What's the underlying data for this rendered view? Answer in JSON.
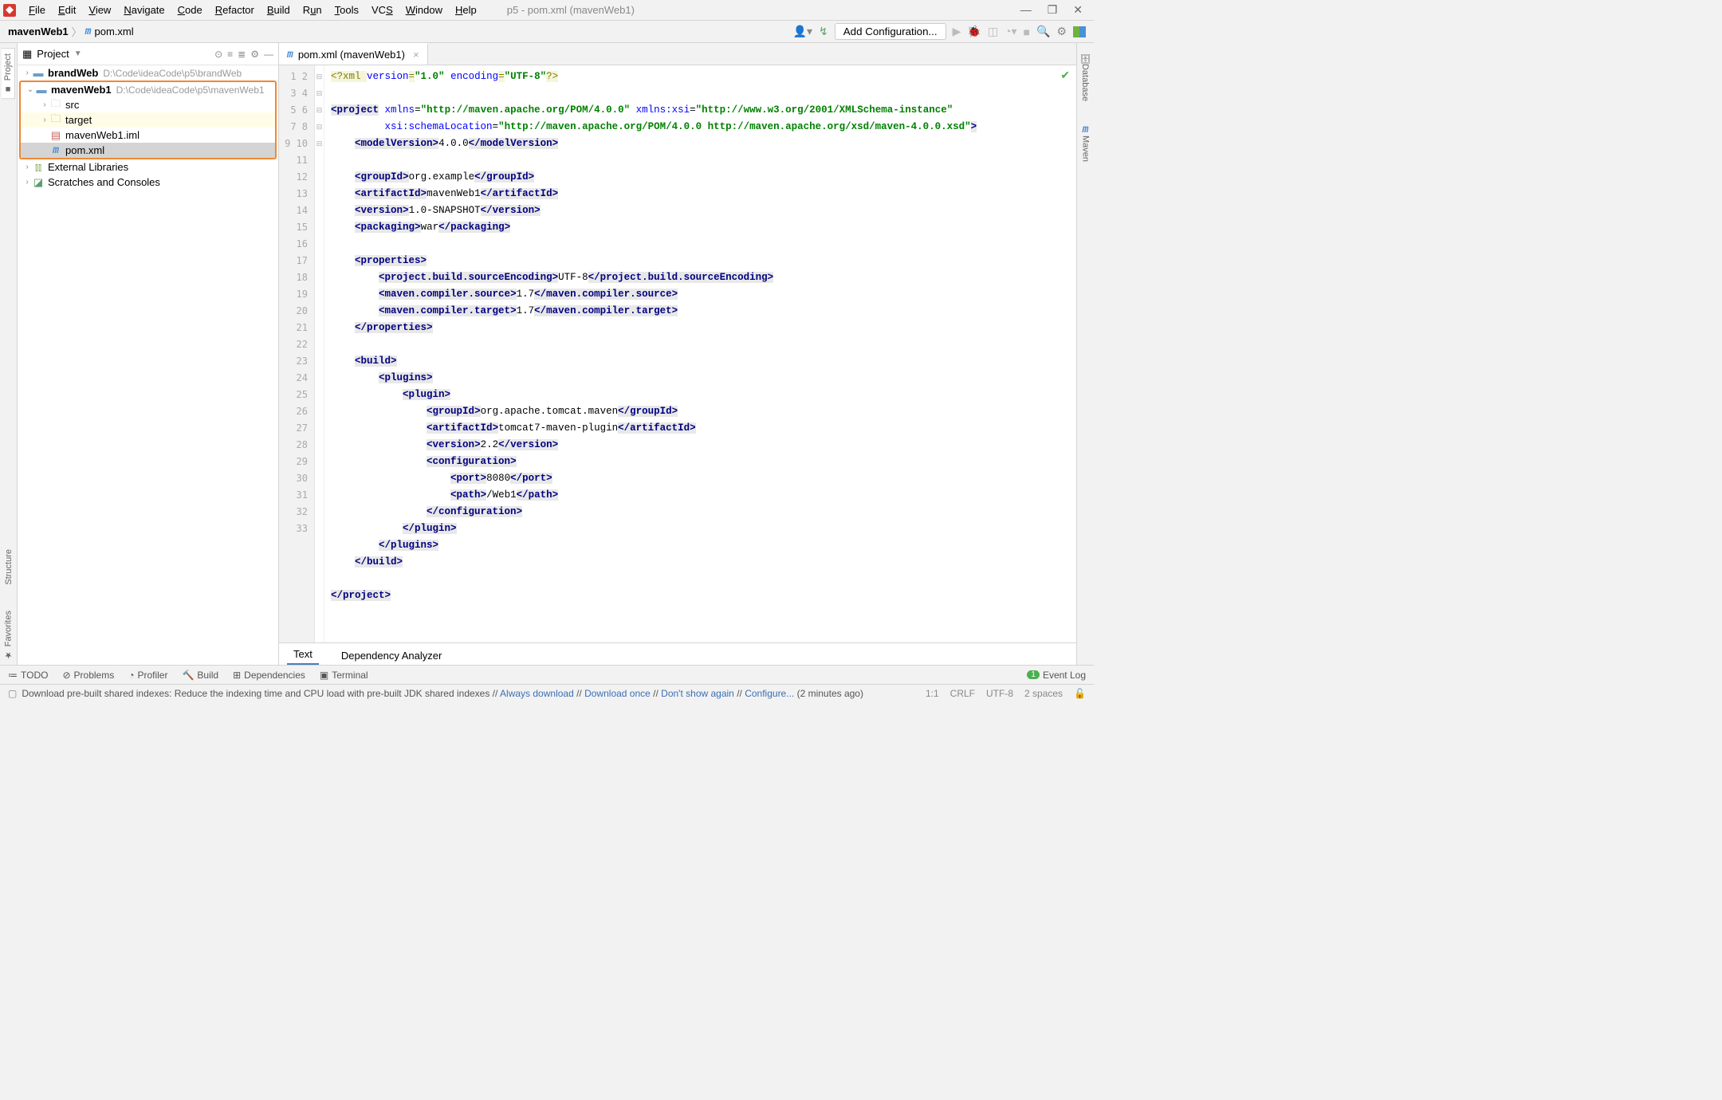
{
  "window": {
    "title": "p5 - pom.xml (mavenWeb1)"
  },
  "menu": [
    "File",
    "Edit",
    "View",
    "Navigate",
    "Code",
    "Refactor",
    "Build",
    "Run",
    "Tools",
    "VCS",
    "Window",
    "Help"
  ],
  "breadcrumb": {
    "project": "mavenWeb1",
    "file": "pom.xml"
  },
  "navRight": {
    "configBtn": "Add Configuration..."
  },
  "projectPanel": {
    "title": "Project"
  },
  "tree": {
    "brandWeb": {
      "name": "brandWeb",
      "path": "D:\\Code\\ideaCode\\p5\\brandWeb"
    },
    "mavenWeb1": {
      "name": "mavenWeb1",
      "path": "D:\\Code\\ideaCode\\p5\\mavenWeb1",
      "children": {
        "src": "src",
        "target": "target",
        "iml": "mavenWeb1.iml",
        "pom": "pom.xml"
      }
    },
    "extLib": "External Libraries",
    "scratches": "Scratches and Consoles"
  },
  "editorTab": {
    "label": "pom.xml (mavenWeb1)"
  },
  "code": {
    "l1": {
      "pi1": "<?xml ",
      "a1": "version",
      "v1": "\"1.0\"",
      "a2": " encoding",
      "v2": "\"UTF-8\"",
      "pi2": "?>"
    },
    "l3": {
      "tag": "project",
      "a1": "xmlns",
      "v1": "\"http://maven.apache.org/POM/4.0.0\"",
      "a2": " xmlns:xsi",
      "v2": "\"http://www.w3.org/2001/XMLSchema-instance\""
    },
    "l4": {
      "a1": "xsi:schemaLocation",
      "v1": "\"http://maven.apache.org/POM/4.0.0 http://maven.apache.org/xsd/maven-4.0.0.xsd\""
    },
    "l5": {
      "tag": "modelVersion",
      "txt": "4.0.0"
    },
    "l7": {
      "tag": "groupId",
      "txt": "org.example"
    },
    "l8": {
      "tag": "artifactId",
      "txt": "mavenWeb1"
    },
    "l9": {
      "tag": "version",
      "txt": "1.0-SNAPSHOT"
    },
    "l10": {
      "tag": "packaging",
      "txt": "war"
    },
    "l12": {
      "tag": "properties"
    },
    "l13": {
      "tag": "project.build.sourceEncoding",
      "txt": "UTF-8"
    },
    "l14": {
      "tag": "maven.compiler.source",
      "txt": "1.7"
    },
    "l15": {
      "tag": "maven.compiler.target",
      "txt": "1.7"
    },
    "l18": {
      "tag": "build"
    },
    "l19": {
      "tag": "plugins"
    },
    "l20": {
      "tag": "plugin"
    },
    "l21": {
      "tag": "groupId",
      "txt": "org.apache.tomcat.maven"
    },
    "l22": {
      "tag": "artifactId",
      "txt": "tomcat7-maven-plugin"
    },
    "l23": {
      "tag": "version",
      "txt": "2.2"
    },
    "l24": {
      "tag": "configuration"
    },
    "l25": {
      "tag": "port",
      "txt": "8080"
    },
    "l26": {
      "tag": "path",
      "txt": "/Web1"
    },
    "l32": {
      "tag": "project"
    }
  },
  "bottomTabs": {
    "text": "Text",
    "dep": "Dependency Analyzer"
  },
  "toolWindows": {
    "todo": "TODO",
    "problems": "Problems",
    "profiler": "Profiler",
    "build": "Build",
    "dependencies": "Dependencies",
    "terminal": "Terminal",
    "eventLog": "Event Log"
  },
  "leftTabs": {
    "project": "Project",
    "structure": "Structure",
    "favorites": "Favorites"
  },
  "rightTabs": {
    "database": "Database",
    "maven": "Maven"
  },
  "status": {
    "msg1": "Download pre-built shared indexes: Reduce the indexing time and CPU load with pre-built JDK shared indexes",
    "always": "Always download",
    "once": "Download once",
    "dont": "Don't show again",
    "conf": "Configure...",
    "time": "(2 minutes ago)",
    "pos": "1:1",
    "le": "CRLF",
    "enc": "UTF-8",
    "indent": "2 spaces"
  }
}
